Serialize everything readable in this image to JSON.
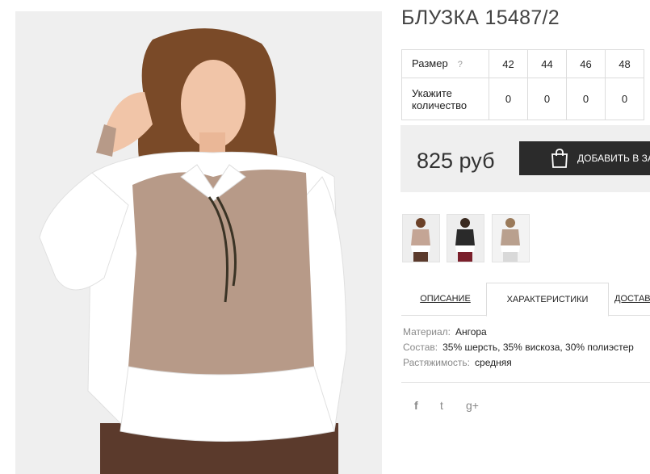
{
  "product": {
    "title": "БЛУЗКА 15487/2"
  },
  "sizes": {
    "size_label": "Размер",
    "help": "?",
    "qty_label_line1": "Укажите",
    "qty_label_line2": "количество",
    "columns": [
      "42",
      "44",
      "46",
      "48"
    ],
    "quantities": [
      "0",
      "0",
      "0",
      "0"
    ]
  },
  "price": {
    "value": "825 руб"
  },
  "cart": {
    "label": "ДОБАВИТЬ В ЗАКАЗ"
  },
  "tabs": [
    "ОПИСАНИЕ",
    "ХАРАКТЕРИСТИКИ",
    "ДОСТАВКА"
  ],
  "specs": [
    {
      "key": "Материал:",
      "value": "Ангора"
    },
    {
      "key": "Состав:",
      "value": "35% шерсть, 35% вискоза, 30% полиэстер"
    },
    {
      "key": "Растяжимость:",
      "value": "средняя"
    }
  ],
  "social": {
    "facebook": "f",
    "twitter": "t",
    "googleplus": "g+"
  },
  "colors": {
    "accent": "#2b2b2b",
    "price_bg": "#efefef"
  },
  "icons": [
    "bag-icon",
    "facebook-icon",
    "twitter-icon",
    "google-plus-icon"
  ]
}
